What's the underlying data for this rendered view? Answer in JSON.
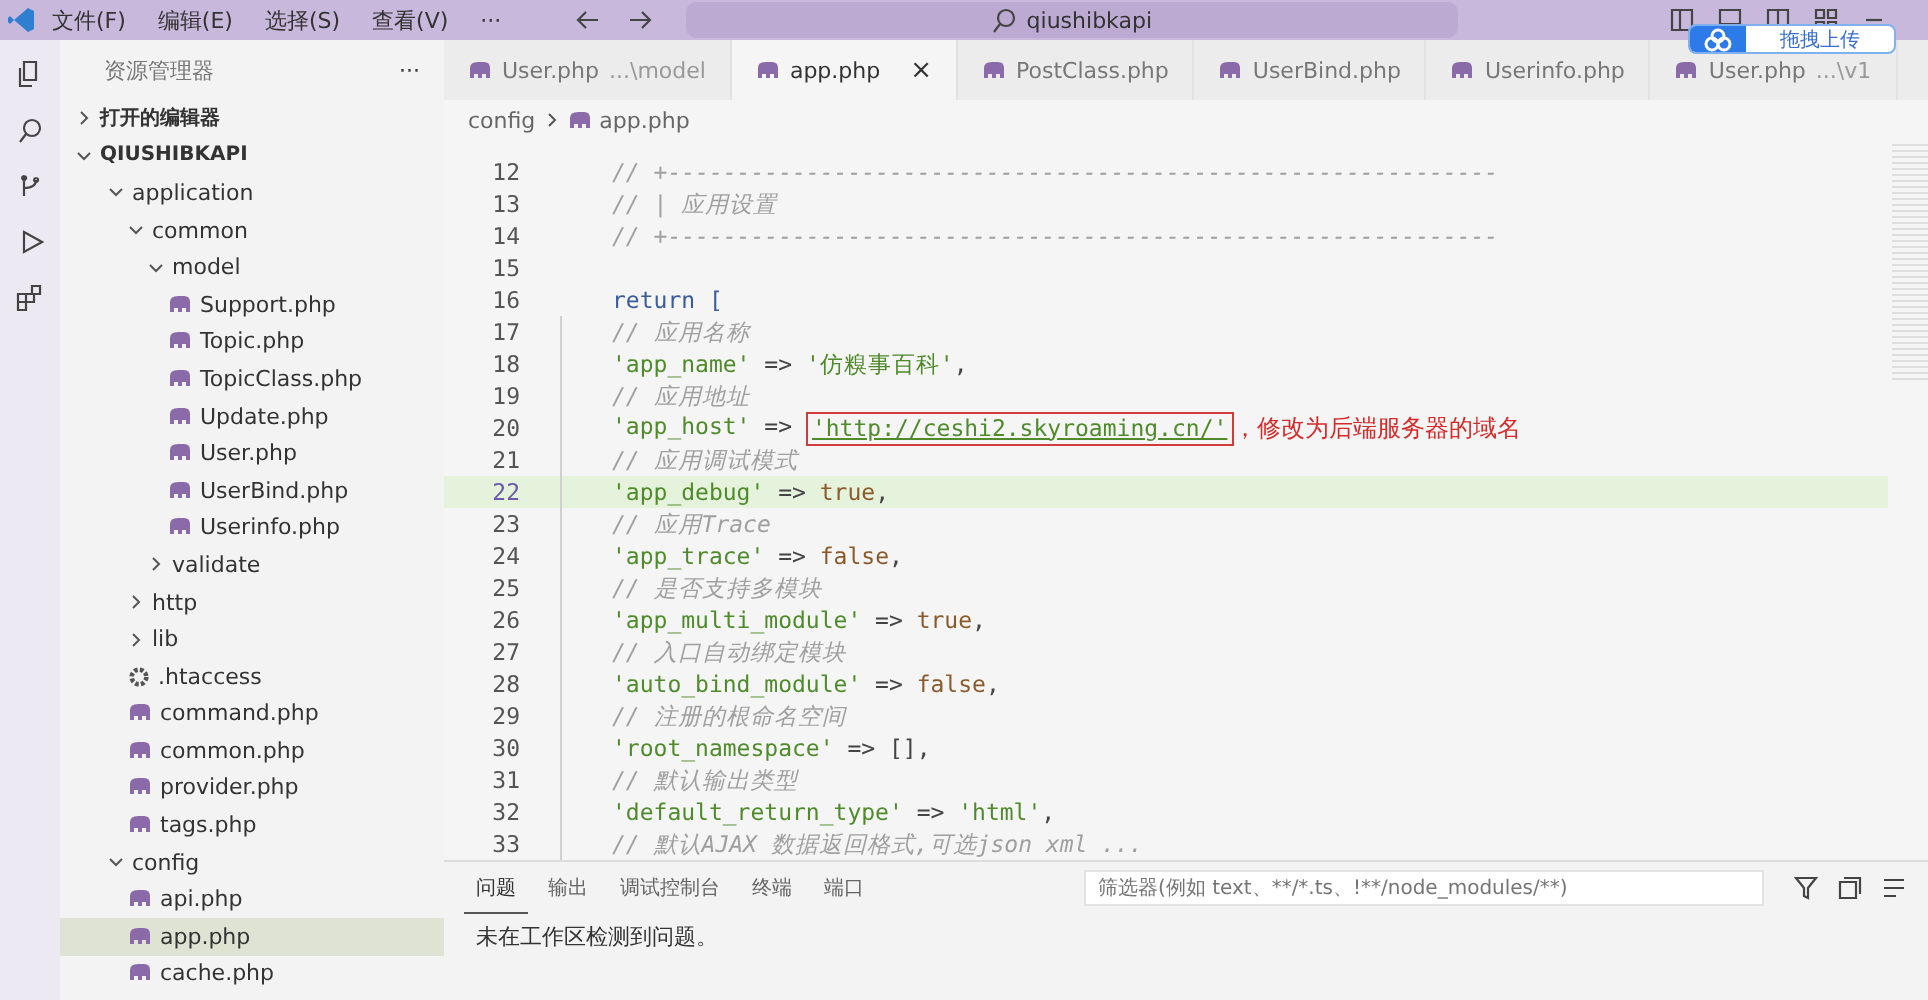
{
  "titlebar": {
    "menus": [
      "文件(F)",
      "编辑(E)",
      "选择(S)",
      "查看(V)",
      "···"
    ],
    "search": "qiushibkapi"
  },
  "upload_widget": {
    "label": "拖拽上传"
  },
  "sidebar": {
    "title": "资源管理器",
    "more": "···",
    "sections": [
      {
        "label": "打开的编辑器",
        "expanded": false
      },
      {
        "label": "QIUSHIBKAPI",
        "expanded": true
      }
    ],
    "tree": [
      {
        "name": "application",
        "kind": "folder",
        "expanded": true,
        "selected": false,
        "children": [
          {
            "name": "common",
            "kind": "folder",
            "expanded": true,
            "selected": false,
            "children": [
              {
                "name": "model",
                "kind": "folder",
                "expanded": true,
                "selected": false,
                "children": [
                  {
                    "name": "Support.php",
                    "kind": "php",
                    "selected": false
                  },
                  {
                    "name": "Topic.php",
                    "kind": "php",
                    "selected": false
                  },
                  {
                    "name": "TopicClass.php",
                    "kind": "php",
                    "selected": false
                  },
                  {
                    "name": "Update.php",
                    "kind": "php",
                    "selected": false
                  },
                  {
                    "name": "User.php",
                    "kind": "php",
                    "selected": false
                  },
                  {
                    "name": "UserBind.php",
                    "kind": "php",
                    "selected": false
                  },
                  {
                    "name": "Userinfo.php",
                    "kind": "php",
                    "selected": false
                  }
                ]
              },
              {
                "name": "validate",
                "kind": "folder",
                "expanded": false,
                "selected": false
              }
            ]
          },
          {
            "name": "http",
            "kind": "folder",
            "expanded": false,
            "selected": false
          },
          {
            "name": "lib",
            "kind": "folder",
            "expanded": false,
            "selected": false
          },
          {
            "name": ".htaccess",
            "kind": "config",
            "selected": false
          },
          {
            "name": "command.php",
            "kind": "php",
            "selected": false
          },
          {
            "name": "common.php",
            "kind": "php",
            "selected": false
          },
          {
            "name": "provider.php",
            "kind": "php",
            "selected": false
          },
          {
            "name": "tags.php",
            "kind": "php",
            "selected": false
          }
        ]
      },
      {
        "name": "config",
        "kind": "folder",
        "expanded": true,
        "selected": false,
        "children": [
          {
            "name": "api.php",
            "kind": "php",
            "selected": false
          },
          {
            "name": "app.php",
            "kind": "php",
            "selected": true
          },
          {
            "name": "cache.php",
            "kind": "php",
            "selected": false
          }
        ]
      }
    ]
  },
  "tabs": [
    {
      "label": "User.php",
      "detail": "...\\model",
      "selected": false
    },
    {
      "label": "app.php",
      "selected": true,
      "close": "×"
    },
    {
      "label": "PostClass.php",
      "selected": false
    },
    {
      "label": "UserBind.php",
      "selected": false
    },
    {
      "label": "Userinfo.php",
      "selected": false
    },
    {
      "label": "User.php",
      "detail": "...\\v1",
      "selected": false
    }
  ],
  "breadcrumb": [
    "config",
    "app.php"
  ],
  "code": [
    {
      "n": "12",
      "inner": false,
      "highlighted": false,
      "tokens": [
        {
          "kind": "comment",
          "text": "// +------------------------------------------------------------"
        }
      ]
    },
    {
      "n": "13",
      "inner": false,
      "highlighted": false,
      "tokens": [
        {
          "kind": "comment",
          "text": "// | 应用设置"
        }
      ]
    },
    {
      "n": "14",
      "inner": false,
      "highlighted": false,
      "tokens": [
        {
          "kind": "comment",
          "text": "// +------------------------------------------------------------"
        }
      ]
    },
    {
      "n": "15",
      "inner": false,
      "highlighted": false
    },
    {
      "n": "16",
      "inner": false,
      "highlighted": false,
      "tokens": [
        {
          "kind": "keyword",
          "text": "return"
        },
        {
          "kind": "bracket",
          "text": " ["
        }
      ]
    },
    {
      "n": "17",
      "inner": true,
      "highlighted": false,
      "tokens": [
        {
          "kind": "comment",
          "text": "// 应用名称"
        }
      ]
    },
    {
      "n": "18",
      "inner": true,
      "highlighted": false,
      "tokens": [
        {
          "kind": "string",
          "text": "'app_name'"
        },
        {
          "kind": "plain",
          "text": " => "
        },
        {
          "kind": "string",
          "text": "'仿糗事百科'"
        },
        {
          "kind": "plain",
          "text": ","
        }
      ]
    },
    {
      "n": "19",
      "inner": true,
      "highlighted": false,
      "tokens": [
        {
          "kind": "comment",
          "text": "// 应用地址"
        }
      ]
    },
    {
      "n": "20",
      "inner": true,
      "highlighted": false,
      "tokens": [
        {
          "kind": "string",
          "text": "'app_host'"
        },
        {
          "kind": "plain",
          "text": " => "
        },
        {
          "kind": "boxed",
          "text": "'http://ceshi2.skyroaming.cn/'"
        },
        {
          "kind": "note",
          "text": "，修改为后端服务器的域名"
        }
      ]
    },
    {
      "n": "21",
      "inner": true,
      "highlighted": false,
      "tokens": [
        {
          "kind": "comment",
          "text": "// 应用调试模式"
        }
      ]
    },
    {
      "n": "22",
      "inner": true,
      "highlighted": true,
      "tokens": [
        {
          "kind": "string",
          "text": "'app_debug'"
        },
        {
          "kind": "plain",
          "text": " => "
        },
        {
          "kind": "constant",
          "text": "true"
        },
        {
          "kind": "plain",
          "text": ","
        }
      ]
    },
    {
      "n": "23",
      "inner": true,
      "highlighted": false,
      "tokens": [
        {
          "kind": "comment",
          "text": "// 应用Trace"
        }
      ]
    },
    {
      "n": "24",
      "inner": true,
      "highlighted": false,
      "tokens": [
        {
          "kind": "string",
          "text": "'app_trace'"
        },
        {
          "kind": "plain",
          "text": " => "
        },
        {
          "kind": "constant",
          "text": "false"
        },
        {
          "kind": "plain",
          "text": ","
        }
      ]
    },
    {
      "n": "25",
      "inner": true,
      "highlighted": false,
      "tokens": [
        {
          "kind": "comment",
          "text": "// 是否支持多模块"
        }
      ]
    },
    {
      "n": "26",
      "inner": true,
      "highlighted": false,
      "tokens": [
        {
          "kind": "string",
          "text": "'app_multi_module'"
        },
        {
          "kind": "plain",
          "text": " => "
        },
        {
          "kind": "constant",
          "text": "true"
        },
        {
          "kind": "plain",
          "text": ","
        }
      ]
    },
    {
      "n": "27",
      "inner": true,
      "highlighted": false,
      "tokens": [
        {
          "kind": "comment",
          "text": "// 入口自动绑定模块"
        }
      ]
    },
    {
      "n": "28",
      "inner": true,
      "highlighted": false,
      "tokens": [
        {
          "kind": "string",
          "text": "'auto_bind_module'"
        },
        {
          "kind": "plain",
          "text": " => "
        },
        {
          "kind": "constant",
          "text": "false"
        },
        {
          "kind": "plain",
          "text": ","
        }
      ]
    },
    {
      "n": "29",
      "inner": true,
      "highlighted": false,
      "tokens": [
        {
          "kind": "comment",
          "text": "// 注册的根命名空间"
        }
      ]
    },
    {
      "n": "30",
      "inner": true,
      "highlighted": false,
      "tokens": [
        {
          "kind": "string",
          "text": "'root_namespace'"
        },
        {
          "kind": "plain",
          "text": " => [],"
        }
      ]
    },
    {
      "n": "31",
      "inner": true,
      "highlighted": false,
      "tokens": [
        {
          "kind": "comment",
          "text": "// 默认输出类型"
        }
      ]
    },
    {
      "n": "32",
      "inner": true,
      "highlighted": false,
      "tokens": [
        {
          "kind": "string",
          "text": "'default_return_type'"
        },
        {
          "kind": "plain",
          "text": " => "
        },
        {
          "kind": "string",
          "text": "'html'"
        },
        {
          "kind": "plain",
          "text": ","
        }
      ]
    },
    {
      "n": "33",
      "inner": true,
      "highlighted": false,
      "tokens": [
        {
          "kind": "comment",
          "text": "// 默认AJAX 数据返回格式,可选json xml ..."
        }
      ]
    }
  ],
  "panel": {
    "tabs": [
      {
        "label": "问题",
        "selected": true
      },
      {
        "label": "输出",
        "selected": false
      },
      {
        "label": "调试控制台",
        "selected": false
      },
      {
        "label": "终端",
        "selected": false
      },
      {
        "label": "端口",
        "selected": false
      }
    ],
    "filter_placeholder": "筛选器(例如 text、**/*.ts、!**/node_modules/**)",
    "message": "未在工作区检测到问题。"
  }
}
